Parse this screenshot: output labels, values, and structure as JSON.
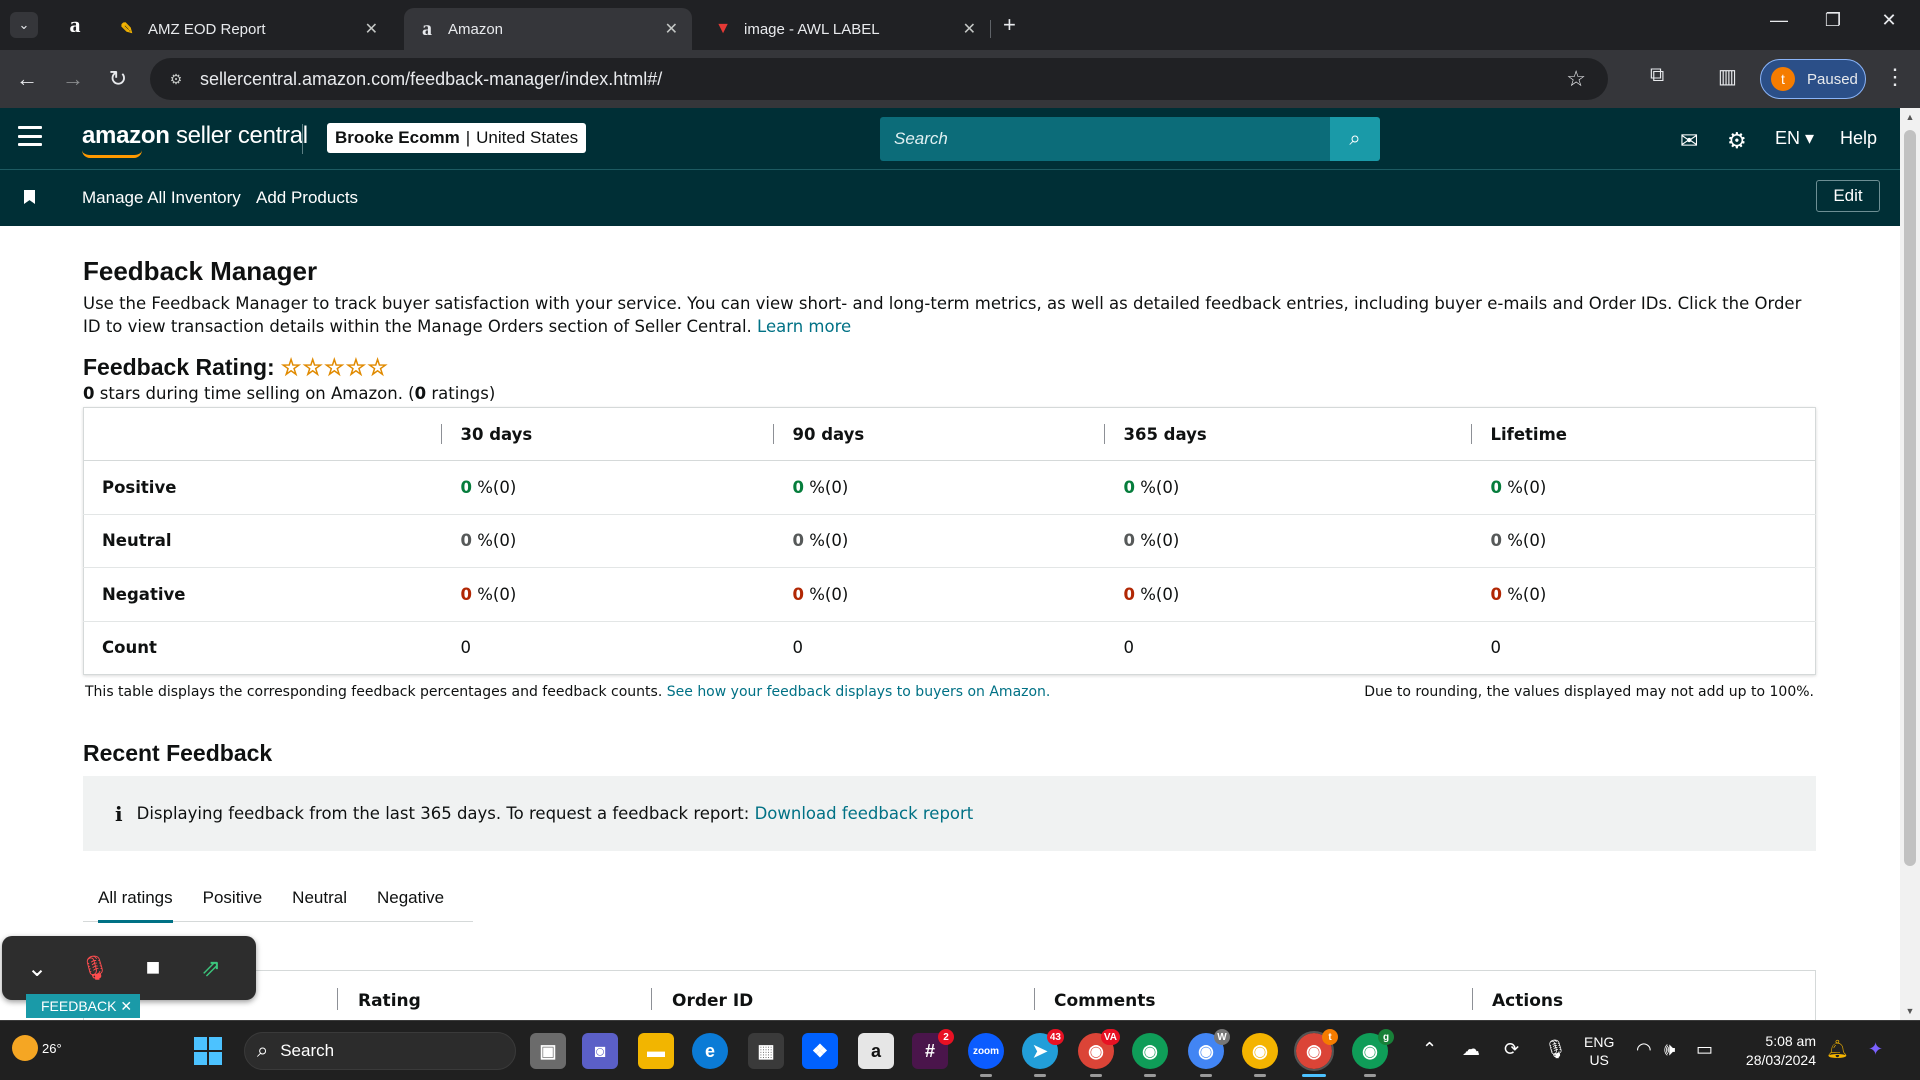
{
  "browser": {
    "tabs": [
      {
        "title": "AMZ EOD Report",
        "favicon": "pencil-icon"
      },
      {
        "title": "Amazon",
        "favicon": "amazon-icon"
      },
      {
        "title": "image - AWL LABEL",
        "favicon": "label-icon"
      }
    ],
    "url": "sellercentral.amazon.com/feedback-manager/index.html#/",
    "profile_initial": "t",
    "profile_status": "Paused"
  },
  "header": {
    "logo_brand": "amazon",
    "logo_product": "seller central",
    "account_name": "Brooke Ecomm",
    "account_region": "United States",
    "search_placeholder": "Search",
    "language": "EN",
    "help": "Help"
  },
  "nav": {
    "links": [
      "Manage All Inventory",
      "Add Products"
    ],
    "edit": "Edit"
  },
  "page": {
    "title": "Feedback Manager",
    "description": "Use the Feedback Manager to track buyer satisfaction with your service. You can view short- and long-term metrics, as well as detailed feedback entries, including buyer e-mails and Order IDs. Click the Order ID to view transaction details within the Manage Orders section of Seller Central.",
    "learn_more": "Learn more",
    "rating_title": "Feedback Rating:",
    "rating_stars": 0,
    "rating_stars_glyphs": "☆☆☆☆☆",
    "rating_value": "0",
    "rating_text_mid": " stars during time selling on Amazon. (",
    "rating_count": "0",
    "rating_text_end": " ratings)"
  },
  "feedback_table": {
    "columns": [
      "30 days",
      "90 days",
      "365 days",
      "Lifetime"
    ],
    "rows": [
      {
        "label": "Positive",
        "cells": [
          "0",
          "0",
          "0",
          "0"
        ],
        "suffix": "%(0)"
      },
      {
        "label": "Neutral",
        "cells": [
          "0",
          "0",
          "0",
          "0"
        ],
        "suffix": "%(0)"
      },
      {
        "label": "Negative",
        "cells": [
          "0",
          "0",
          "0",
          "0"
        ],
        "suffix": "%(0)"
      },
      {
        "label": "Count",
        "cells": [
          "0",
          "0",
          "0",
          "0"
        ]
      }
    ],
    "note": "This table displays the corresponding feedback percentages and feedback counts.",
    "note_link": "See how your feedback displays to buyers on Amazon.",
    "rounding_note": "Due to rounding, the values displayed may not add up to 100%."
  },
  "recent": {
    "title": "Recent Feedback",
    "info_text": "Displaying feedback from the last 365 days. To request a feedback report:",
    "info_link": "Download feedback report",
    "tabs": [
      "All ratings",
      "Positive",
      "Neutral",
      "Negative"
    ],
    "selected_tab": "All ratings",
    "columns": [
      "Rating",
      "Order ID",
      "Comments",
      "Actions"
    ]
  },
  "overlay": {
    "feedback_tag": "FEEDBACK"
  },
  "taskbar": {
    "temperature": "26°",
    "search_label": "Search",
    "lang_top": "ENG",
    "lang_bottom": "US",
    "time": "5:08 am",
    "date": "28/03/2024"
  },
  "colors": {
    "header_bg": "#002f36",
    "link": "#007185",
    "positive": "#067d3c",
    "negative": "#b12704",
    "star": "#e08a00"
  }
}
